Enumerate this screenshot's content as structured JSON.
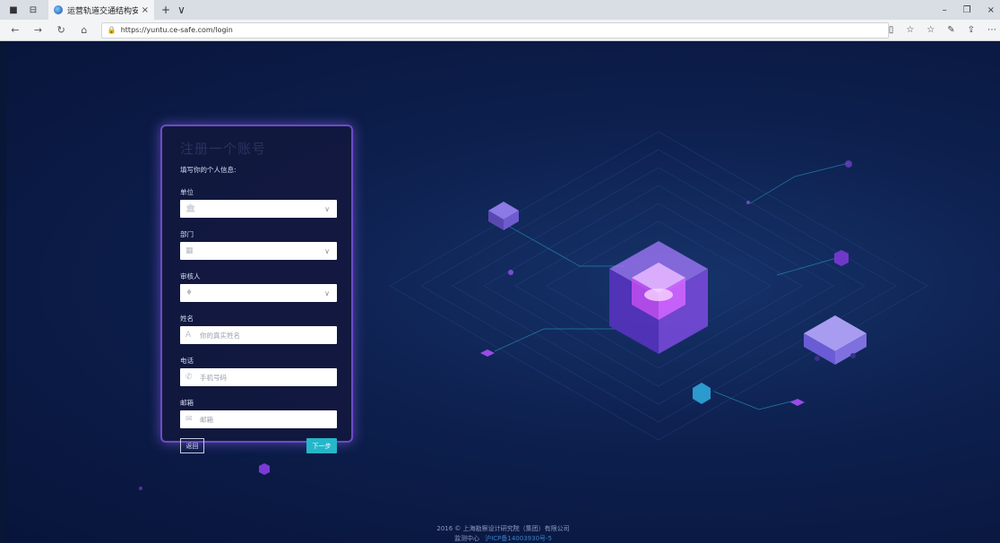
{
  "browser": {
    "tab_title": "运营轨道交通结构安全",
    "tab_close": "×",
    "new_tab": "+",
    "tab_menu": "∨",
    "url": "https://yuntu.ce-safe.com/login",
    "win_min": "–",
    "win_max": "❐",
    "win_close": "×"
  },
  "card": {
    "title": "注册一个账号",
    "subtitle": "填写你的个人信息:",
    "fields": [
      {
        "label": "单位",
        "placeholder": "",
        "type": "select",
        "icon": "building-icon"
      },
      {
        "label": "部门",
        "placeholder": "",
        "type": "select",
        "icon": "department-icon"
      },
      {
        "label": "审核人",
        "placeholder": "",
        "type": "select",
        "icon": "reviewer-icon"
      },
      {
        "label": "姓名",
        "placeholder": "你的真实姓名",
        "type": "input",
        "icon": "person-icon"
      },
      {
        "label": "电话",
        "placeholder": "手机号码",
        "type": "input",
        "icon": "phone-icon"
      },
      {
        "label": "邮箱",
        "placeholder": "邮箱",
        "type": "input",
        "icon": "mail-icon"
      }
    ],
    "back_label": "返回",
    "next_label": "下一步"
  },
  "footer": {
    "copyright": "2016 © 上海勘察设计研究院（集团）有限公司",
    "center": "监测中心",
    "icp": "沪ICP备14003930号-5"
  },
  "colors": {
    "accent": "#25b7c9",
    "card_border": "#6d4bc8",
    "background": "#0a1636"
  }
}
